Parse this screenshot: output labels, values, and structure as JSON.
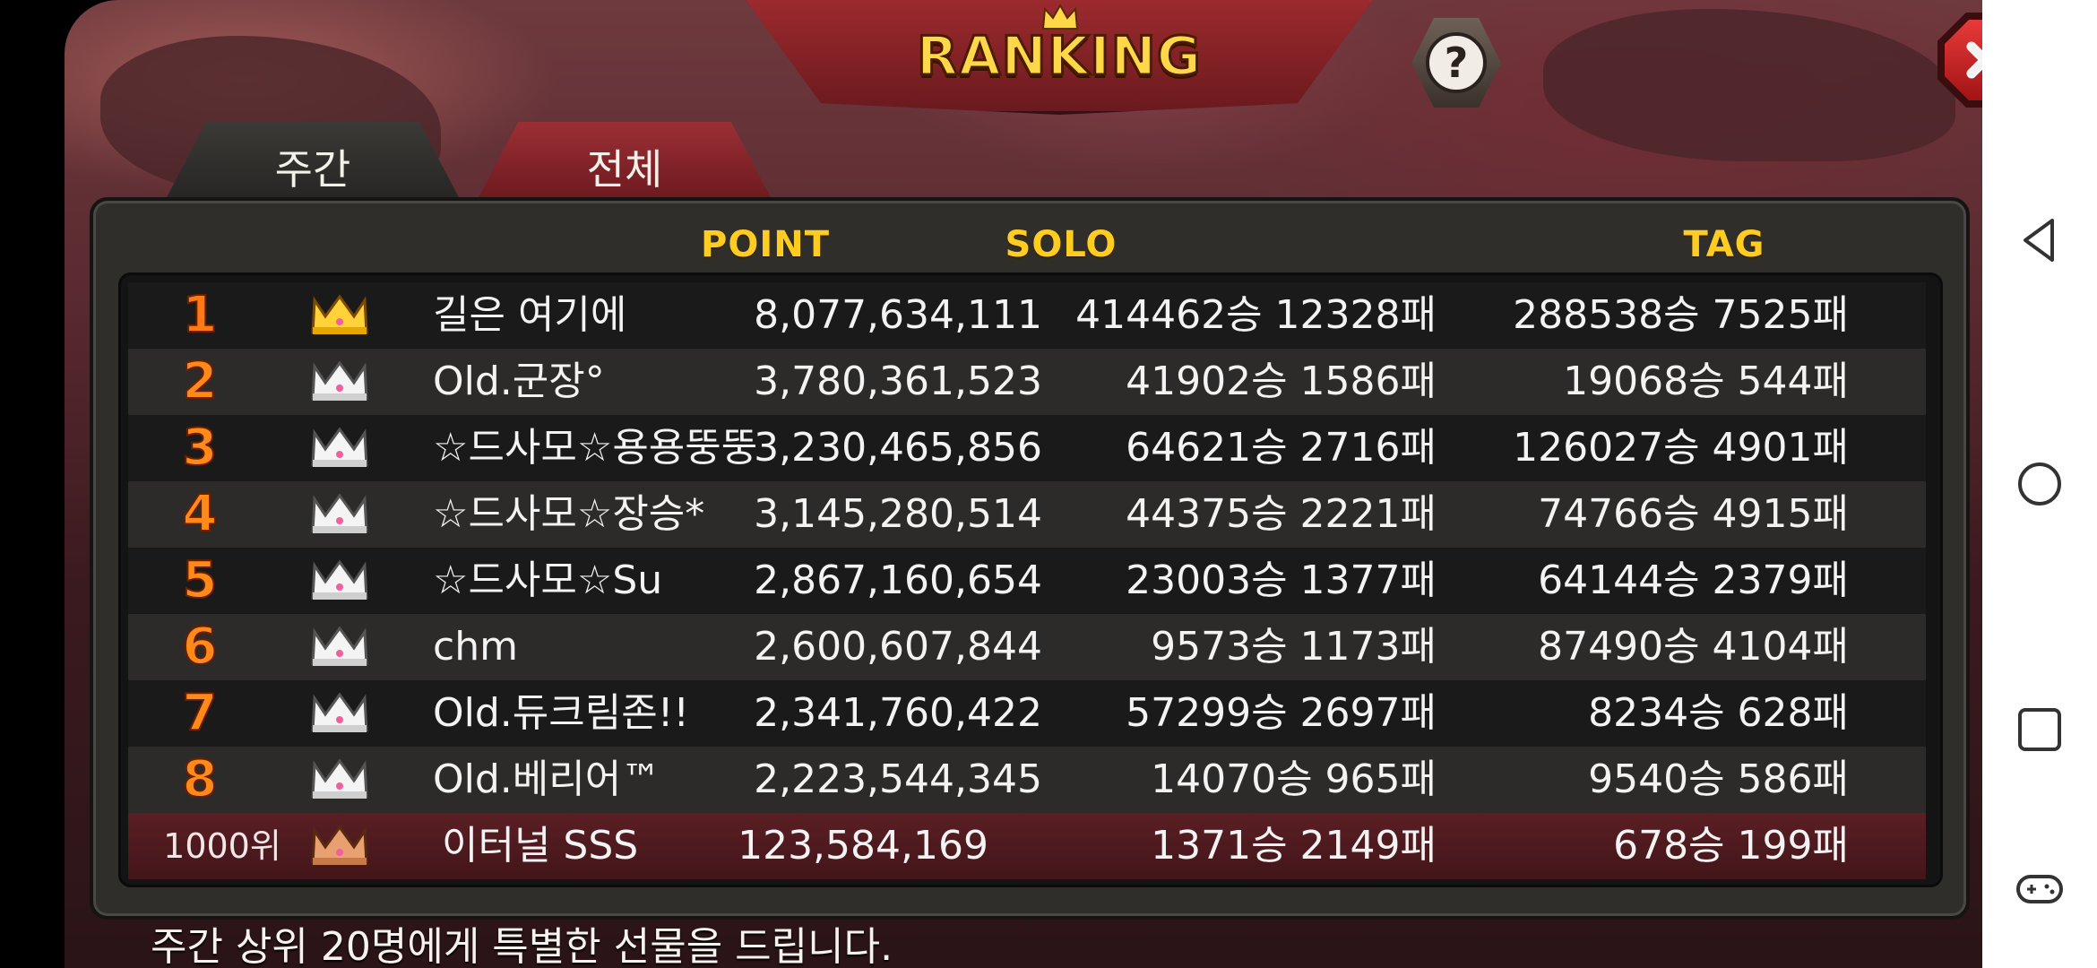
{
  "title": "RANKING",
  "tabs": {
    "weekly": "주간",
    "total": "전체"
  },
  "columns": {
    "point": "POINT",
    "solo": "SOLO",
    "tag": "TAG"
  },
  "rows": [
    {
      "rank": "1",
      "name": "길은 여기에",
      "point": "8,077,634,111",
      "solo": "414462승 12328패",
      "tag": "288538승 7525패",
      "crown": "gold-crown-icon"
    },
    {
      "rank": "2",
      "name": "Old.군장°",
      "point": "3,780,361,523",
      "solo": "41902승 1586패",
      "tag": "19068승 544패",
      "crown": "silver-crown-icon"
    },
    {
      "rank": "3",
      "name": "☆드사모☆용용뚱뚱",
      "point": "3,230,465,856",
      "solo": "64621승 2716패",
      "tag": "126027승 4901패",
      "crown": "silver-crown-icon"
    },
    {
      "rank": "4",
      "name": "☆드사모☆장승*",
      "point": "3,145,280,514",
      "solo": "44375승 2221패",
      "tag": "74766승 4915패",
      "crown": "silver-crown-icon"
    },
    {
      "rank": "5",
      "name": "☆드사모☆Su",
      "point": "2,867,160,654",
      "solo": "23003승 1377패",
      "tag": "64144승 2379패",
      "crown": "silver-crown-icon"
    },
    {
      "rank": "6",
      "name": "chm",
      "point": "2,600,607,844",
      "solo": "9573승 1173패",
      "tag": "87490승 4104패",
      "crown": "silver-crown-icon"
    },
    {
      "rank": "7",
      "name": "Old.듀크림존!!",
      "point": "2,341,760,422",
      "solo": "57299승 2697패",
      "tag": "8234승 628패",
      "crown": "silver-crown-icon"
    },
    {
      "rank": "8",
      "name": "Old.베리어™",
      "point": "2,223,544,345",
      "solo": "14070승 965패",
      "tag": "9540승 586패",
      "crown": "silver-crown-icon"
    }
  ],
  "my_row": {
    "rank": "1000위",
    "name": "이터널 SSS",
    "point": "123,584,169",
    "solo": "1371승 2149패",
    "tag": "678승 199패",
    "crown": "bronze-crown-icon"
  },
  "footer": "주간 상위 20명에게 특별한 선물을 드립니다.",
  "colors": {
    "header_gold": "#ffcc22",
    "rank_orange": "#ff8a1a",
    "close_red": "#e83a3a",
    "my_row_bg": "#5a1f24"
  },
  "navbar": [
    "back-icon",
    "home-icon",
    "recents-icon",
    "game-controller-icon"
  ]
}
